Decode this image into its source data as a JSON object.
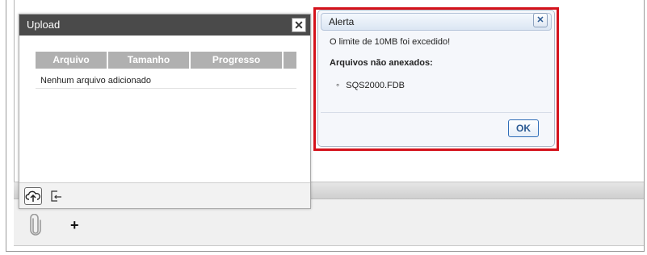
{
  "upload_dialog": {
    "title": "Upload",
    "close_label": "✕",
    "columns": [
      "Arquivo",
      "Tamanho",
      "Progresso",
      ""
    ],
    "empty_message": "Nenhum arquivo adicionado",
    "toolbar": {
      "upload_icon": "cloud-upload-icon",
      "exit_icon": "exit-icon"
    }
  },
  "alert_dialog": {
    "title": "Alerta",
    "close_label": "✕",
    "message": "O limite de 10MB foi excedido!",
    "subtitle": "Arquivos não anexados:",
    "files": [
      "SQS2000.FDB"
    ],
    "ok_label": "OK",
    "highlight_color": "#d4121b"
  },
  "background": {
    "attach_icon": "paperclip-icon",
    "add_label": "+"
  }
}
